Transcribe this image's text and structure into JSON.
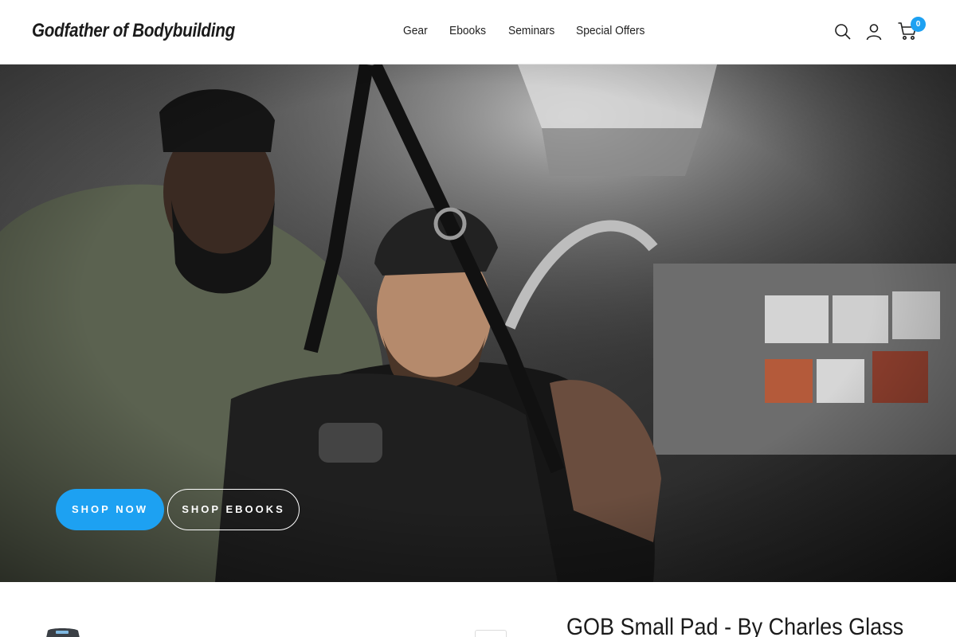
{
  "brand": {
    "name": "Godfather of Bodybuilding",
    "accent": "#1da1f2"
  },
  "nav": {
    "items": [
      {
        "label": "Gear"
      },
      {
        "label": "Ebooks"
      },
      {
        "label": "Seminars"
      },
      {
        "label": "Special Offers"
      }
    ]
  },
  "header_icons": {
    "search": "search-icon",
    "account": "account-icon",
    "cart": "cart-icon",
    "cart_count": "0"
  },
  "hero": {
    "primary_button": "SHOP NOW",
    "secondary_button": "SHOP EBOOKS"
  },
  "product": {
    "title": "GOB Small Pad - By Charles Glass"
  }
}
